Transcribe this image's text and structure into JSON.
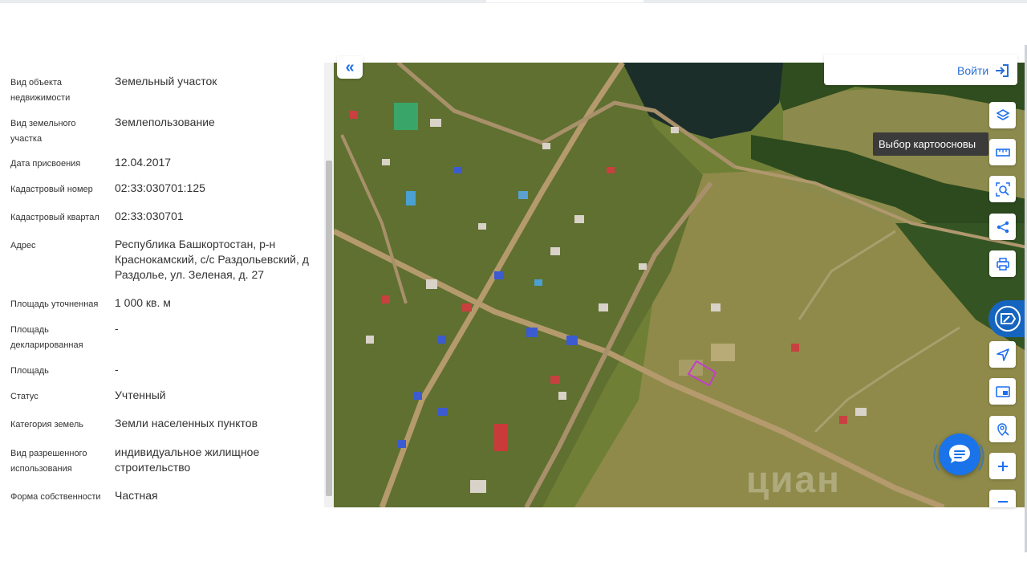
{
  "details": [
    {
      "label": "Вид объекта недвижимости",
      "value": "Земельный участок"
    },
    {
      "label": "Вид земельного участка",
      "value": "Землепользование"
    },
    {
      "label": "Дата присвоения",
      "value": "12.04.2017"
    },
    {
      "label": "Кадастровый номер",
      "value": "02:33:030701:125"
    },
    {
      "label": "Кадастровый квартал",
      "value": "02:33:030701"
    },
    {
      "label": "Адрес",
      "value": "Республика Башкортостан, р-н Краснокамский, с/с Раздольевский, д Раздолье, ул. Зеленая, д. 27"
    },
    {
      "label": "Площадь уточненная",
      "value": "1 000 кв. м"
    },
    {
      "label": "Площадь декларированная",
      "value": "-"
    },
    {
      "label": "Площадь",
      "value": "-"
    },
    {
      "label": "Статус",
      "value": "Учтенный"
    },
    {
      "label": "Категория земель",
      "value": "Земли населенных пунктов"
    },
    {
      "label": "Вид разрешенного использования",
      "value": "индивидуальное жилищное строительство"
    },
    {
      "label": "Форма собственности",
      "value": "Частная"
    }
  ],
  "map": {
    "collapse_glyph": "«",
    "login_label": "Войти",
    "tooltip": "Выбор картоосновы",
    "watermark": "циан",
    "parcel_color": "#c23fc8",
    "tools": [
      "layers-icon",
      "ruler-icon",
      "search-area-icon",
      "share-icon",
      "print-icon",
      "rosreestr-logo-icon",
      "navigate-icon",
      "picture-in-picture-icon",
      "location-search-icon",
      "zoom-in-icon",
      "zoom-out-icon"
    ]
  },
  "colors": {
    "accent": "#1e6ff0",
    "text": "#333333",
    "tooltip_bg": "#3b3b3b"
  }
}
